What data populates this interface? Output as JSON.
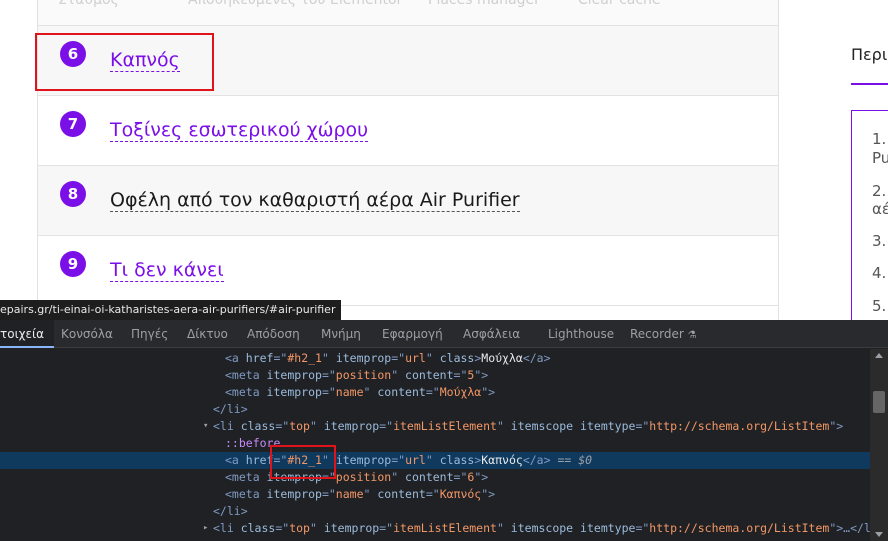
{
  "page": {
    "top_crumbs": [
      "Σταθμός",
      "Αποθηκευμένες του Elementor",
      "Places manager",
      "Clear cache"
    ],
    "toc": [
      {
        "num": "6",
        "label": "Καπνός",
        "dark": false
      },
      {
        "num": "7",
        "label": "Τοξίνες εσωτερικού χώρου",
        "dark": false
      },
      {
        "num": "8",
        "label": "Οφέλη από τον καθαριστή αέρα Air Purifier",
        "dark": true
      },
      {
        "num": "9",
        "label": "Τι δεν κάνει",
        "dark": false
      }
    ],
    "sidebar": {
      "title": "Περι",
      "items": [
        {
          "num": "1.",
          "text": "Pu"
        },
        {
          "num": "2.",
          "text": "αέ"
        },
        {
          "num": "3.",
          "text": ""
        },
        {
          "num": "4.",
          "text": ""
        },
        {
          "num": "5.",
          "text": ""
        }
      ]
    }
  },
  "url_tooltip": "epairs.gr/ti-einai-oi-katharistes-aera-air-purifiers/#air-purifier",
  "devtools": {
    "tabs": [
      "τοιχεία",
      "Κονσόλα",
      "Πηγές",
      "Δίκτυο",
      "Απόδοση",
      "Μνήμη",
      "Εφαρμογή",
      "Ασφάλεια",
      "Lighthouse",
      "Recorder"
    ],
    "active_tab": "τοιχεία",
    "code_lines": [
      {
        "indent": 225,
        "arrow": "",
        "selected": false,
        "parts": [
          [
            "tag",
            "<a "
          ],
          [
            "an",
            "href"
          ],
          [
            "tag",
            "=\""
          ],
          [
            "av",
            "#h2_1"
          ],
          [
            "tag",
            "\" "
          ],
          [
            "an",
            "itemprop"
          ],
          [
            "tag",
            "=\""
          ],
          [
            "av",
            "url"
          ],
          [
            "tag",
            "\" "
          ],
          [
            "an",
            "class"
          ],
          [
            "tag",
            ">"
          ],
          [
            "txt",
            "Μούχλα"
          ],
          [
            "tag",
            "</a>"
          ]
        ]
      },
      {
        "indent": 225,
        "arrow": "",
        "selected": false,
        "parts": [
          [
            "tag",
            "<meta "
          ],
          [
            "an",
            "itemprop"
          ],
          [
            "tag",
            "=\""
          ],
          [
            "av",
            "position"
          ],
          [
            "tag",
            "\" "
          ],
          [
            "an",
            "content"
          ],
          [
            "tag",
            "=\""
          ],
          [
            "av",
            "5"
          ],
          [
            "tag",
            "\">"
          ]
        ]
      },
      {
        "indent": 225,
        "arrow": "",
        "selected": false,
        "parts": [
          [
            "tag",
            "<meta "
          ],
          [
            "an",
            "itemprop"
          ],
          [
            "tag",
            "=\""
          ],
          [
            "av",
            "name"
          ],
          [
            "tag",
            "\" "
          ],
          [
            "an",
            "content"
          ],
          [
            "tag",
            "=\""
          ],
          [
            "av",
            "Μούχλα"
          ],
          [
            "tag",
            "\">"
          ]
        ]
      },
      {
        "indent": 213,
        "arrow": "",
        "selected": false,
        "parts": [
          [
            "tag",
            "</li>"
          ]
        ]
      },
      {
        "indent": 213,
        "arrow": "▾",
        "selected": false,
        "parts": [
          [
            "tag",
            "<li "
          ],
          [
            "an",
            "class"
          ],
          [
            "tag",
            "=\""
          ],
          [
            "av",
            "top"
          ],
          [
            "tag",
            "\" "
          ],
          [
            "an",
            "itemprop"
          ],
          [
            "tag",
            "=\""
          ],
          [
            "av",
            "itemListElement"
          ],
          [
            "tag",
            "\" "
          ],
          [
            "an",
            "itemscope"
          ],
          [
            "tag",
            " "
          ],
          [
            "an",
            "itemtype"
          ],
          [
            "tag",
            "=\""
          ],
          [
            "av",
            "http://schema.org/ListItem"
          ],
          [
            "tag",
            "\">"
          ]
        ]
      },
      {
        "indent": 225,
        "arrow": "",
        "selected": false,
        "parts": [
          [
            "pseudo",
            "::before"
          ]
        ]
      },
      {
        "indent": 225,
        "arrow": "",
        "selected": true,
        "parts": [
          [
            "tag",
            "<a "
          ],
          [
            "an",
            "href"
          ],
          [
            "tag",
            "=\""
          ],
          [
            "av",
            "#h2_1"
          ],
          [
            "tag",
            "\" "
          ],
          [
            "an",
            "itemprop"
          ],
          [
            "tag",
            "=\""
          ],
          [
            "av",
            "url"
          ],
          [
            "tag",
            "\" "
          ],
          [
            "an",
            "class"
          ],
          [
            "tag",
            ">"
          ],
          [
            "txt",
            "Καπνός"
          ],
          [
            "tag",
            "</a>"
          ],
          [
            "eq",
            " == $0"
          ]
        ]
      },
      {
        "indent": 225,
        "arrow": "",
        "selected": false,
        "parts": [
          [
            "tag",
            "<meta "
          ],
          [
            "an",
            "itemprop"
          ],
          [
            "tag",
            "=\""
          ],
          [
            "av",
            "position"
          ],
          [
            "tag",
            "\" "
          ],
          [
            "an",
            "content"
          ],
          [
            "tag",
            "=\""
          ],
          [
            "av",
            "6"
          ],
          [
            "tag",
            "\">"
          ]
        ]
      },
      {
        "indent": 225,
        "arrow": "",
        "selected": false,
        "parts": [
          [
            "tag",
            "<meta "
          ],
          [
            "an",
            "itemprop"
          ],
          [
            "tag",
            "=\""
          ],
          [
            "av",
            "name"
          ],
          [
            "tag",
            "\" "
          ],
          [
            "an",
            "content"
          ],
          [
            "tag",
            "=\""
          ],
          [
            "av",
            "Καπνός"
          ],
          [
            "tag",
            "\">"
          ]
        ]
      },
      {
        "indent": 213,
        "arrow": "",
        "selected": false,
        "parts": [
          [
            "tag",
            "</li>"
          ]
        ]
      },
      {
        "indent": 213,
        "arrow": "▸",
        "selected": false,
        "parts": [
          [
            "tag",
            "<li "
          ],
          [
            "an",
            "class"
          ],
          [
            "tag",
            "=\""
          ],
          [
            "av",
            "top"
          ],
          [
            "tag",
            "\" "
          ],
          [
            "an",
            "itemprop"
          ],
          [
            "tag",
            "=\""
          ],
          [
            "av",
            "itemListElement"
          ],
          [
            "tag",
            "\" "
          ],
          [
            "an",
            "itemscope"
          ],
          [
            "tag",
            " "
          ],
          [
            "an",
            "itemtype"
          ],
          [
            "tag",
            "=\""
          ],
          [
            "av",
            "http://schema.org/ListItem"
          ],
          [
            "tag",
            "\">…</li>"
          ]
        ]
      }
    ]
  },
  "colors": {
    "accent": "#7b0fe8",
    "highlight": "#e0131b",
    "devtools_bg": "#202124",
    "selected_row": "#0f3a5e"
  }
}
